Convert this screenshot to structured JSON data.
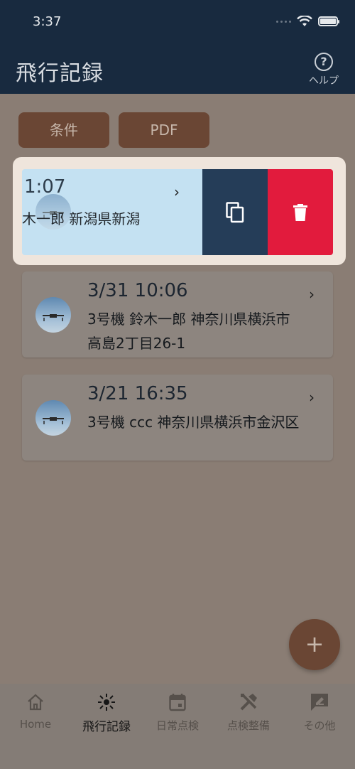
{
  "status_bar": {
    "time": "3:37"
  },
  "header": {
    "title": "飛行記録",
    "help_label": "ヘルプ",
    "help_icon": "help-circle-icon"
  },
  "filters": {
    "condition_label": "条件",
    "pdf_label": "PDF"
  },
  "swiped_record": {
    "time": "1:07",
    "description": "木一郎 新潟県新潟",
    "actions": {
      "copy_icon": "copy-icon",
      "delete_icon": "trash-icon"
    }
  },
  "records": [
    {
      "time": "3/31 10:06",
      "description": "3号機 鈴木一郎 神奈川県横浜市高島2丁目26-1"
    },
    {
      "time": "3/21 16:35",
      "description": "3号機 ccc 神奈川県横浜市金沢区"
    }
  ],
  "fab": {
    "label": "+"
  },
  "nav": [
    {
      "label": "Home",
      "icon": "home-icon"
    },
    {
      "label": "飛行記録",
      "icon": "drone-icon"
    },
    {
      "label": "日常点検",
      "icon": "calendar-icon"
    },
    {
      "label": "点検整備",
      "icon": "tools-icon"
    },
    {
      "label": "その他",
      "icon": "edit-icon"
    }
  ],
  "colors": {
    "header_bg": "#182a3f",
    "accent_brown": "#6a4634",
    "copy_action": "#253d58",
    "delete_action": "#e21b3d",
    "swiped_card": "#c4e1f2"
  }
}
